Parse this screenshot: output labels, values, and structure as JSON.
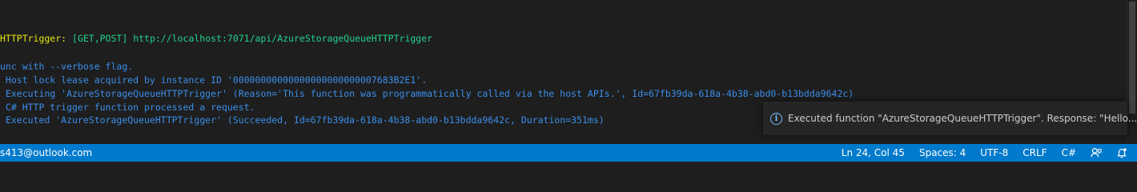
{
  "terminal": {
    "lines": [
      {
        "prefix": "HTTPTrigger: ",
        "methods": "[GET,POST]",
        "url": " http://localhost:7071/api/AzureStorageQueueHTTPTrigger"
      },
      {
        "text": "unc with --verbose flag."
      },
      {
        "text": " Host lock lease acquired by instance ID '00000000000000000000000007683B2E1'."
      },
      {
        "text": " Executing 'AzureStorageQueueHTTPTrigger' (Reason='This function was programmatically called via the host APIs.', Id=67fb39da-618a-4b38-abd0-b13bdda9642c)"
      },
      {
        "text": " C# HTTP trigger function processed a request."
      },
      {
        "text": " Executed 'AzureStorageQueueHTTPTrigger' (Succeeded, Id=67fb39da-618a-4b38-abd0-b13bdda9642c, Duration=351ms)"
      }
    ]
  },
  "notification": {
    "icon": "info-icon",
    "message": "Executed function \"AzureStorageQueueHTTPTrigger\". Response: \"Hello..."
  },
  "statusbar": {
    "account": "s413@outlook.com",
    "position": "Ln 24, Col 45",
    "spaces": "Spaces: 4",
    "encoding": "UTF-8",
    "eol": "CRLF",
    "language": "C#",
    "icons": [
      "feedback-icon",
      "notifications-bell-icon"
    ]
  },
  "colors": {
    "background": "#1e1e1e",
    "statusbar": "#007acc",
    "log_blue": "#3b8eea",
    "trigger_yellow": "#e5e510",
    "url_green": "#23d18b"
  }
}
